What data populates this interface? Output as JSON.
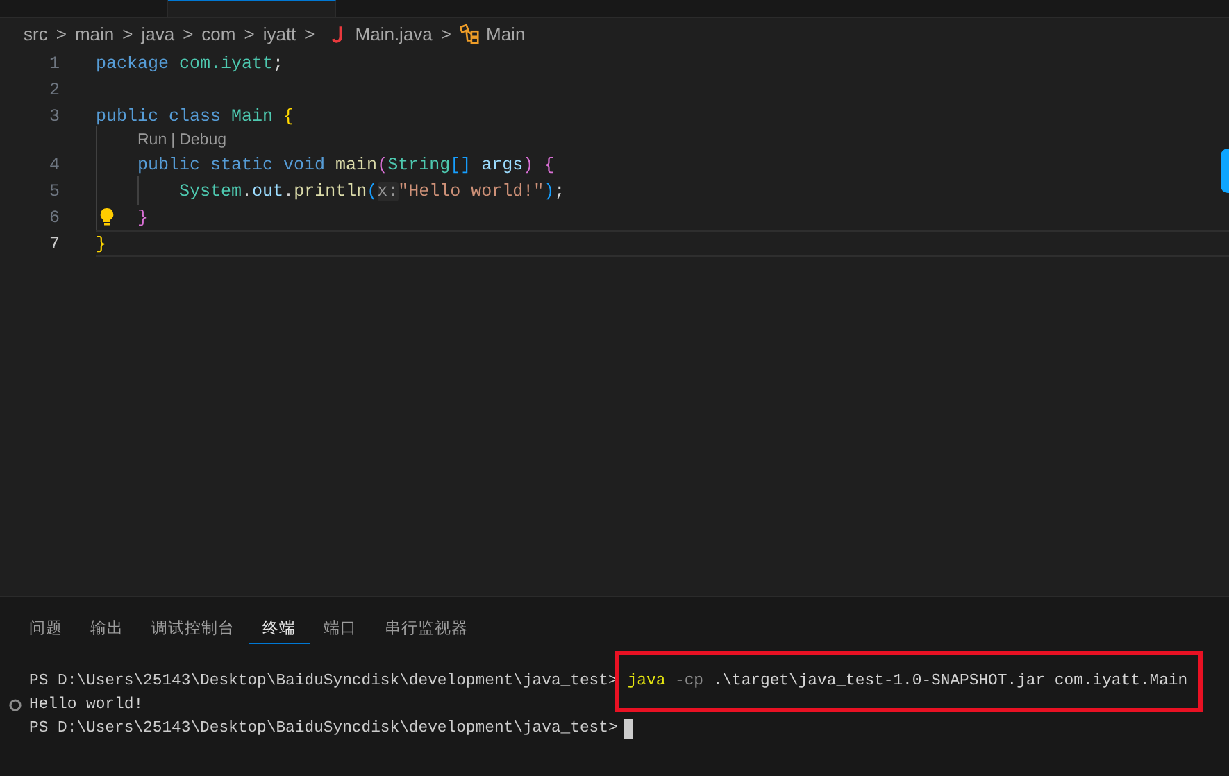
{
  "tabs": [
    {
      "selected": false
    },
    {
      "selected": true
    }
  ],
  "breadcrumb": [
    {
      "label": "src",
      "kind": "folder"
    },
    {
      "label": "main",
      "kind": "folder"
    },
    {
      "label": "java",
      "kind": "folder"
    },
    {
      "label": "com",
      "kind": "folder"
    },
    {
      "label": "iyatt",
      "kind": "folder"
    },
    {
      "label": "Main.java",
      "kind": "java-file"
    },
    {
      "label": "Main",
      "kind": "class"
    }
  ],
  "breadcrumb_separator": ">",
  "editor": {
    "lines": [
      {
        "kind": "code",
        "number": "1",
        "words": [
          [
            {
              "kind": "keyword",
              "text": "package"
            }
          ],
          [
            {
              "kind": "type",
              "text": "com.iyatt"
            },
            {
              "kind": "plain",
              "text": ";"
            }
          ]
        ]
      },
      {
        "kind": "code",
        "number": "2"
      },
      {
        "kind": "code",
        "number": "3",
        "words": [
          [
            {
              "kind": "keyword",
              "text": "public"
            }
          ],
          [
            {
              "kind": "keyword",
              "text": "class"
            }
          ],
          [
            {
              "kind": "type",
              "text": "Main"
            }
          ],
          [
            {
              "kind": "bracket1",
              "text": "{"
            }
          ]
        ],
        "children": [
          {
            "kind": "codelens",
            "items": [
              "Run",
              "Debug"
            ],
            "separator": "|"
          },
          {
            "kind": "code",
            "number": "4",
            "words": [
              [
                {
                  "kind": "keyword",
                  "text": "public"
                }
              ],
              [
                {
                  "kind": "keyword",
                  "text": "static"
                }
              ],
              [
                {
                  "kind": "keyword",
                  "text": "void"
                }
              ],
              [
                {
                  "kind": "function",
                  "text": "main"
                },
                {
                  "kind": "bracket2",
                  "text": "("
                },
                {
                  "kind": "type",
                  "text": "String"
                },
                {
                  "kind": "bracket3",
                  "text": "[]"
                }
              ],
              [
                {
                  "kind": "variable",
                  "text": "args"
                },
                {
                  "kind": "bracket2",
                  "text": ")"
                }
              ],
              [
                {
                  "kind": "bracket2",
                  "text": "{"
                }
              ]
            ],
            "children": [
              {
                "kind": "code",
                "number": "5",
                "words": [
                  [
                    {
                      "kind": "type",
                      "text": "System"
                    },
                    {
                      "kind": "plain",
                      "text": "."
                    },
                    {
                      "kind": "variable",
                      "text": "out"
                    },
                    {
                      "kind": "plain",
                      "text": "."
                    },
                    {
                      "kind": "function",
                      "text": "println"
                    },
                    {
                      "kind": "bracket3",
                      "text": "("
                    },
                    {
                      "kind": "hint",
                      "text": "x:"
                    },
                    {
                      "kind": "string",
                      "text": "\"Hello world!\""
                    },
                    {
                      "kind": "bracket3",
                      "text": ")"
                    },
                    {
                      "kind": "plain",
                      "text": ";"
                    }
                  ]
                ]
              }
            ]
          },
          {
            "kind": "code",
            "number": "6",
            "lightbulb": true,
            "words": [
              [
                {
                  "kind": "bracket2",
                  "text": "}"
                }
              ]
            ]
          }
        ]
      },
      {
        "kind": "code",
        "number": "7",
        "current": true,
        "words": [
          [
            {
              "kind": "bracket1",
              "text": "}"
            }
          ]
        ]
      }
    ]
  },
  "panel": {
    "tabs": [
      {
        "label": "问题",
        "selected": false
      },
      {
        "label": "输出",
        "selected": false
      },
      {
        "label": "调试控制台",
        "selected": false
      },
      {
        "label": "终端",
        "selected": true
      },
      {
        "label": "端口",
        "selected": false
      },
      {
        "label": "串行监视器",
        "selected": false
      }
    ],
    "terminal": [
      {
        "prompt": "PS D:\\Users\\25143\\Desktop\\BaiduSyncdisk\\development\\java_test>",
        "tokens": [
          {
            "kind": "command",
            "text": "java"
          },
          {
            "kind": "flag",
            "text": "-cp"
          },
          {
            "kind": "plain",
            "text": ".\\target\\java_test-1.0-SNAPSHOT.jar"
          },
          {
            "kind": "plain",
            "text": "com.iyatt.Main"
          }
        ],
        "highlighted": true
      },
      {
        "tokens": [
          {
            "kind": "plain",
            "text": "Hello world!"
          }
        ],
        "marker": true
      },
      {
        "prompt": "PS D:\\Users\\25143\\Desktop\\BaiduSyncdisk\\development\\java_test>",
        "cursor": true
      }
    ]
  }
}
